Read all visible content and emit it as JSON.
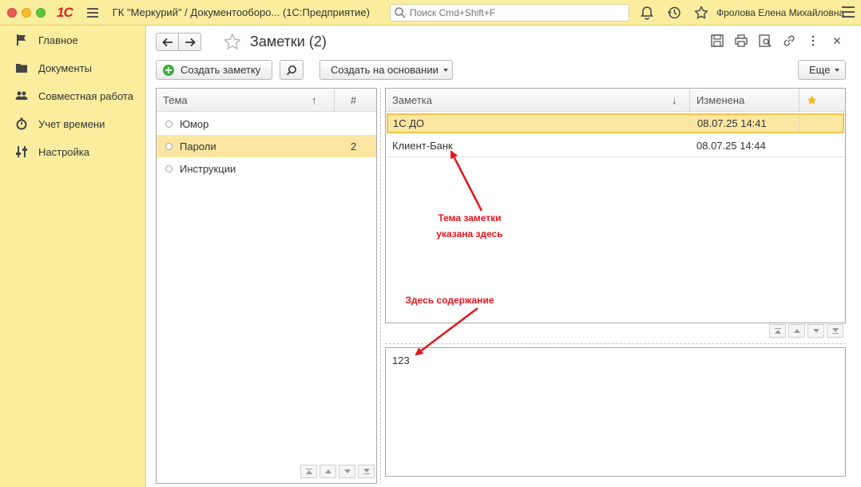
{
  "titlebar": {
    "logo": "1С",
    "app_title": "ГК \"Меркурий\" / Документооборо...  (1С:Предприятие)",
    "search_placeholder": "Поиск Cmd+Shift+F",
    "user": "Фролова Елена Михайловна",
    "icons": [
      "bell-icon",
      "history-icon",
      "star-icon"
    ]
  },
  "sidebar": {
    "items": [
      {
        "label": "Главное",
        "icon": "flag-icon"
      },
      {
        "label": "Документы",
        "icon": "folder-icon"
      },
      {
        "label": "Совместная работа",
        "icon": "people-icon"
      },
      {
        "label": "Учет времени",
        "icon": "stopwatch-icon"
      },
      {
        "label": "Настройка",
        "icon": "sliders-icon"
      }
    ]
  },
  "page": {
    "title": "Заметки (2)",
    "toolbar": {
      "create_label": "Создать заметку",
      "basis_label": "Создать на основании",
      "more_label": "Еще"
    }
  },
  "topics": {
    "columns": {
      "topic": "Тема",
      "count": "#"
    },
    "sort_arrow": "↑",
    "rows": [
      {
        "name": "Юмор",
        "count": ""
      },
      {
        "name": "Пароли",
        "count": "2",
        "selected": true
      },
      {
        "name": "Инструкции",
        "count": ""
      }
    ]
  },
  "notes": {
    "columns": {
      "note": "Заметка",
      "changed": "Изменена"
    },
    "sort_arrow": "↓",
    "rows": [
      {
        "name": "1С ДО",
        "changed": "08.07.25 14:41",
        "selected": true
      },
      {
        "name": "Клиент-Банк",
        "changed": "08.07.25 14:44"
      }
    ]
  },
  "content": {
    "text": "123"
  },
  "annotations": {
    "topic_line1": "Тема заметки",
    "topic_line2": "указана здесь",
    "content": "Здесь содержание"
  },
  "colors": {
    "accent_yellow": "#fbed9e",
    "selection": "#fbe7a3",
    "annotation_red": "#e4151c"
  }
}
